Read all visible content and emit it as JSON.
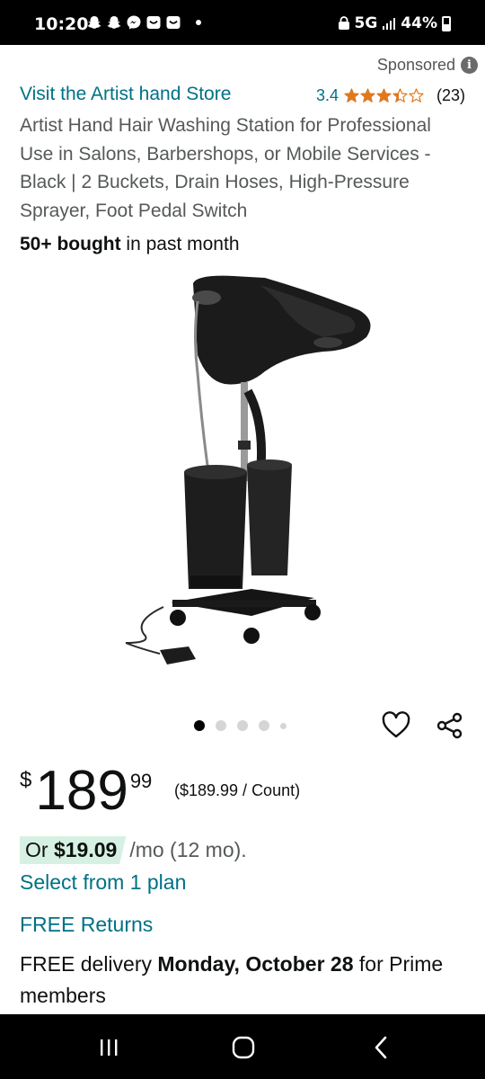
{
  "status_bar": {
    "time": "10:20",
    "network": "5G",
    "battery": "44%",
    "left_icons": [
      "snapchat-icon",
      "snapchat-icon",
      "messenger-icon",
      "app-icon",
      "app-icon"
    ]
  },
  "sponsored": {
    "label": "Sponsored",
    "info_icon": "info-icon"
  },
  "store": {
    "link_text": "Visit the Artist hand Store"
  },
  "rating": {
    "value": "3.4",
    "stars": 3.4,
    "max_stars": 5,
    "count": "(23)"
  },
  "product": {
    "title": "Artist Hand Hair Washing Station for Professional Use in Salons, Barbershops, or Mobile Services - Black | 2 Buckets, Drain Hoses, High-Pressure Sprayer, Foot Pedal Switch",
    "bought_bold": "50+ bought",
    "bought_rest": " in past month"
  },
  "carousel": {
    "total_dots": 5,
    "active_index": 0
  },
  "actions": {
    "wishlist_icon": "heart-icon",
    "share_icon": "share-icon"
  },
  "price": {
    "symbol": "$",
    "whole": "189",
    "fraction": "99",
    "unit_price": "($189.99 / Count)"
  },
  "installment": {
    "prefix": "Or ",
    "amount": "$19.09",
    "suffix": " /mo (12 mo).",
    "select_plan": "Select from 1 plan"
  },
  "returns": {
    "label": "FREE Returns"
  },
  "delivery": {
    "prefix": "FREE delivery ",
    "date": "Monday, October 28",
    "suffix": " for Prime members"
  },
  "colors": {
    "link": "#007185",
    "installment_bg": "#d6f1e3",
    "star": "#de7921"
  },
  "nav_bar": {
    "buttons": [
      "recents-icon",
      "home-icon",
      "back-icon"
    ]
  }
}
